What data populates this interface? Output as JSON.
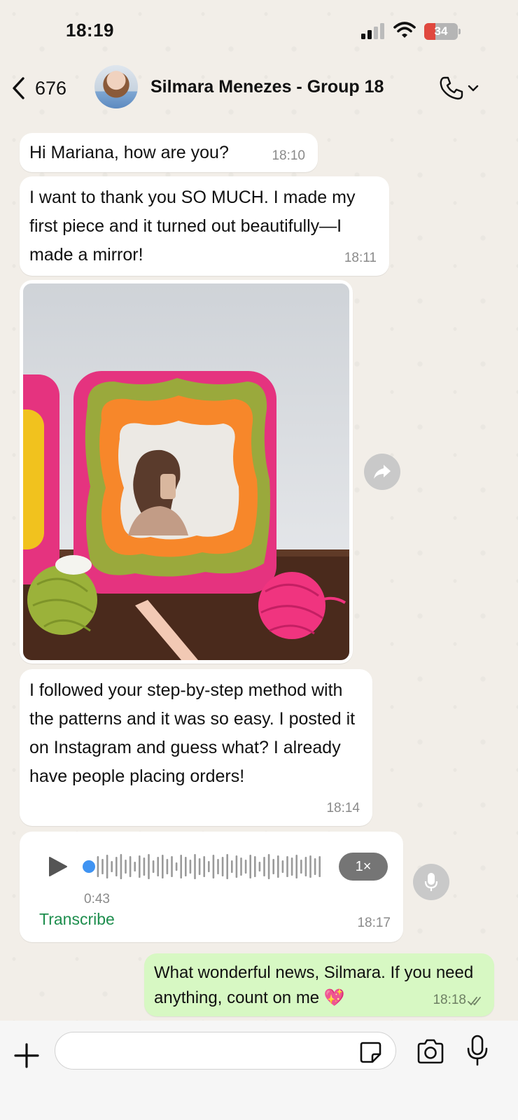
{
  "status_bar": {
    "time": "18:19",
    "battery": "34",
    "battery_level": 0.34
  },
  "header": {
    "back_count": "676",
    "contact_name": "Silmara Menezes - Group 18"
  },
  "messages": [
    {
      "text": "Hi Mariana, how are you?",
      "time": "18:10"
    },
    {
      "text": "I want to thank you SO MUCH. I made my first piece and it turned out beautifully—I made a mirror!",
      "time": "18:11"
    },
    {
      "text": "I followed your step-by-step method with the patterns and it was so easy. I posted it on Instagram and guess what? I already have people placing orders!",
      "time": "18:14"
    }
  ],
  "voice_note": {
    "duration": "0:43",
    "speed": "1×",
    "transcribe_label": "Transcribe",
    "time": "18:17",
    "progress": 0
  },
  "outgoing": {
    "text": "What wonderful news, Silmara. If you need anything, count on me 💖",
    "time": "18:18"
  },
  "composer": {
    "value": "",
    "placeholder": ""
  },
  "colors": {
    "incoming_bubble": "#ffffff",
    "outgoing_bubble": "#d7f8c3",
    "accent_green": "#1e8e4e",
    "voice_dot": "#3f93f2",
    "battery_low": "#e0483e"
  },
  "icons": {
    "back": "chevron-left-icon",
    "call": "phone-icon",
    "forward": "share-forward-icon",
    "play": "play-icon",
    "mic": "microphone-icon",
    "plus": "plus-icon",
    "sticker": "sticker-icon",
    "camera": "camera-icon",
    "read": "double-check-icon"
  }
}
